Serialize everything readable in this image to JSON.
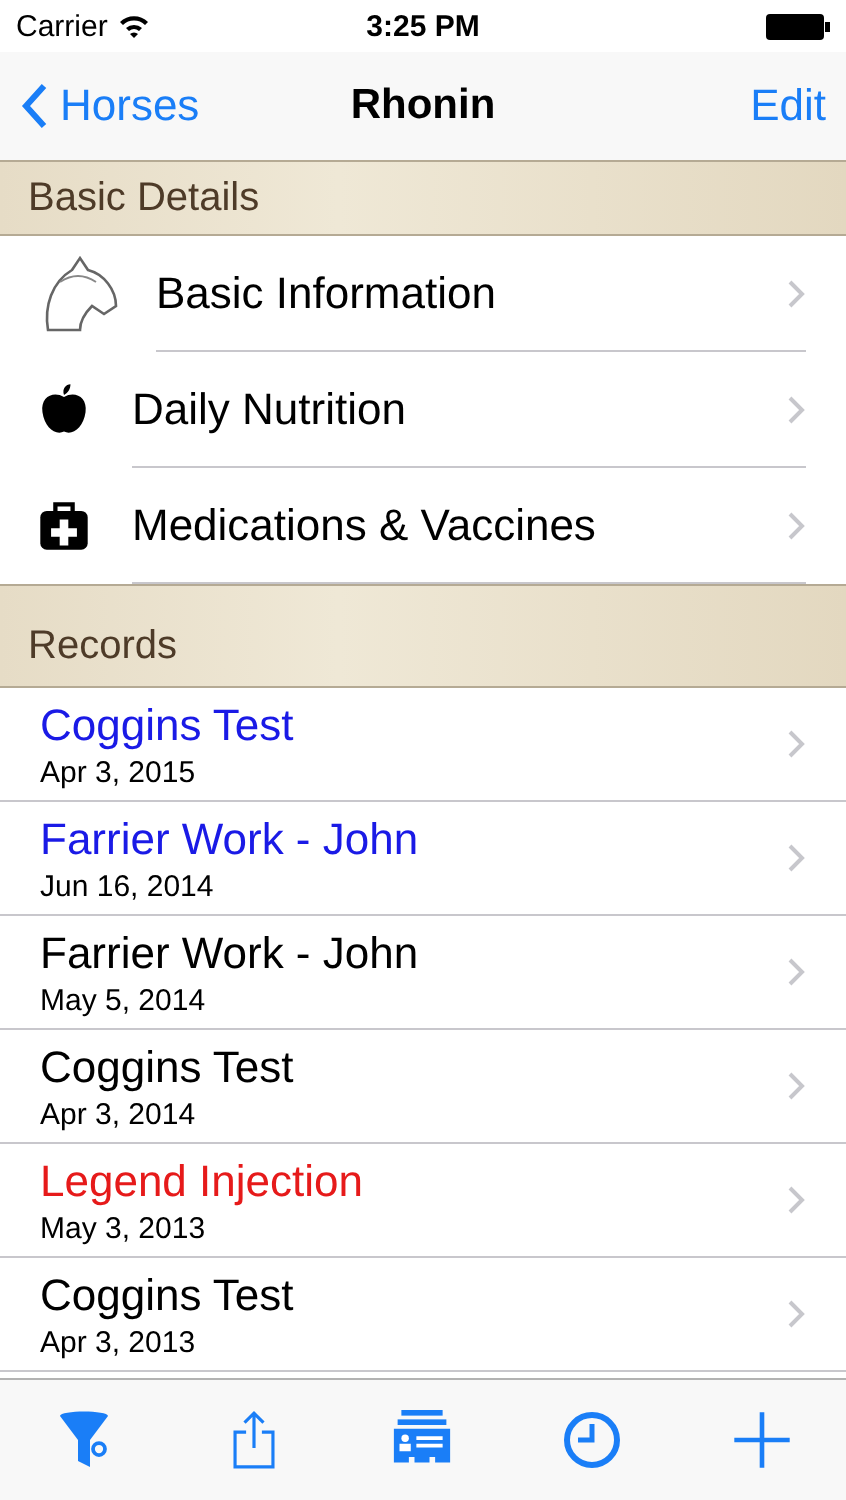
{
  "status_bar": {
    "carrier": "Carrier",
    "time": "3:25 PM"
  },
  "nav": {
    "back": "Horses",
    "title": "Rhonin",
    "action": "Edit"
  },
  "sections": [
    {
      "title": "Basic Details",
      "items": [
        {
          "kind": "horse",
          "label": "Basic Information"
        },
        {
          "kind": "apple",
          "label": "Daily Nutrition"
        },
        {
          "kind": "medkit",
          "label": "Medications & Vaccines"
        }
      ]
    }
  ],
  "records": {
    "title": "Records",
    "rows": [
      {
        "name": "Coggins Test",
        "date": "Apr 3, 2015",
        "color": "#1a1ae6"
      },
      {
        "name": "Farrier Work - John",
        "date": "Jun 16, 2014",
        "color": "#1a1ae6"
      },
      {
        "name": "Farrier Work - John",
        "date": "May 5, 2014",
        "color": "#000000"
      },
      {
        "name": "Coggins Test",
        "date": "Apr 3, 2014",
        "color": "#000000"
      },
      {
        "name": "Legend Injection",
        "date": "May 3, 2013",
        "color": "#e61a1a"
      },
      {
        "name": "Coggins Test",
        "date": "Apr 3, 2013",
        "color": "#000000"
      }
    ]
  },
  "toolbar": [
    {
      "kind": "filter"
    },
    {
      "kind": "share"
    },
    {
      "kind": "cards"
    },
    {
      "kind": "clock"
    },
    {
      "kind": "add"
    }
  ]
}
